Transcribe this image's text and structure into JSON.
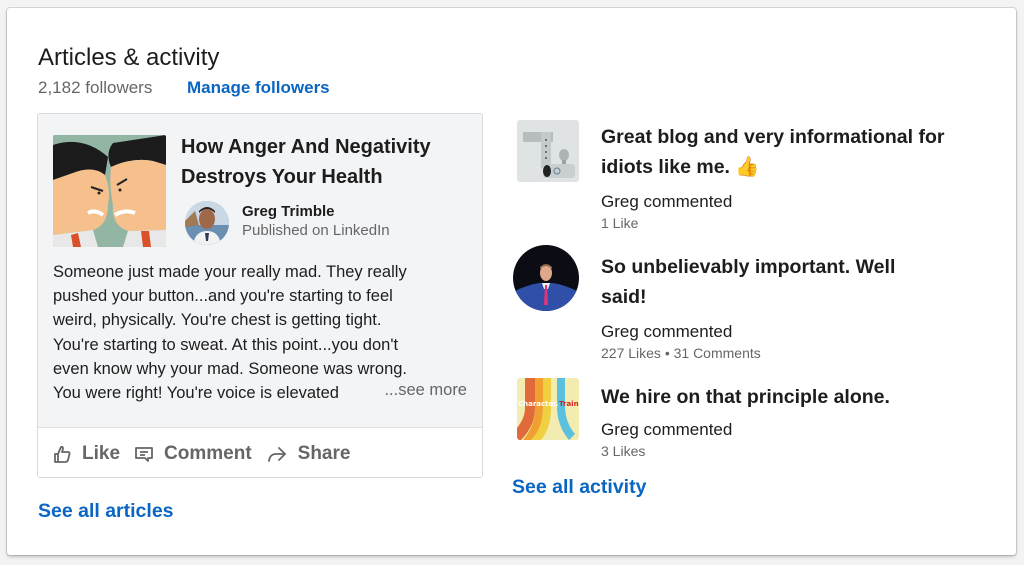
{
  "header": {
    "title": "Articles & activity",
    "followers": "2,182 followers",
    "manage_followers": "Manage followers"
  },
  "article": {
    "title": "How Anger And Negativity Destroys Your Health",
    "thumbnail": "angry-businessmen-illustration",
    "author": {
      "name": "Greg Trimble",
      "subtitle": "Published on LinkedIn"
    },
    "excerpt_lines": [
      "Someone just made your really mad. They really",
      "pushed your button...and you're starting to feel",
      "weird, physically. You're chest is getting tight.",
      "You're starting to sweat. At this point...you don't",
      "even know why your mad. Someone was wrong.",
      "You were right! You're voice is elevated"
    ],
    "see_more": "...see more",
    "actions": {
      "like": "Like",
      "comment": "Comment",
      "share": "Share"
    }
  },
  "see_all_articles": "See all articles",
  "activity": [
    {
      "text": "Great blog and very informational for idiots like me. 👍",
      "thumbnail": "trailer-hitch-photo",
      "meta": "Greg commented",
      "stats": "1 Like"
    },
    {
      "text": "So unbelievably important. Well said!",
      "thumbnail": "speaker-on-stage-photo",
      "meta": "Greg commented",
      "stats": "227 Likes • 31 Comments"
    },
    {
      "text": "We hire on that principle alone.",
      "thumbnail": "character-train-graphic",
      "thumbnail_text": [
        "Character.",
        "Train"
      ],
      "meta": "Greg commented",
      "stats": "3 Likes"
    }
  ],
  "see_all_activity": "See all activity",
  "colors": {
    "link": "#0a66c2",
    "text_primary": "#1d1d1d",
    "text_secondary": "#666666",
    "article_bg": "#f3f4f6"
  }
}
